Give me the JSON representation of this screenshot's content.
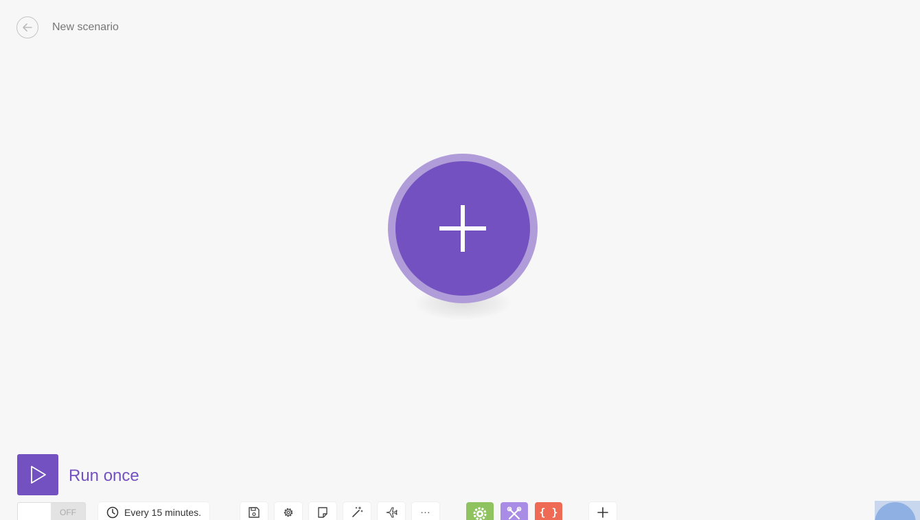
{
  "header": {
    "title": "New scenario",
    "back_icon": "arrow-left-icon"
  },
  "canvas": {
    "add_module_icon": "plus-icon",
    "colors": {
      "module_fill": "#7451c0",
      "module_ring": "#b09cd9"
    }
  },
  "run": {
    "label": "Run once",
    "icon": "play-icon"
  },
  "scheduling": {
    "toggle_state": "OFF",
    "schedule_label": "Every 15 minutes."
  },
  "toolbar": {
    "tools": [
      "save-icon",
      "gear-icon",
      "note-icon",
      "magic-wand-icon",
      "airplane-icon"
    ],
    "more_label": "...",
    "modules": [
      {
        "name": "flow-control",
        "color": "#8ec360"
      },
      {
        "name": "tools",
        "color": "#a98ce6"
      },
      {
        "name": "text-parser",
        "color": "#ef6a55",
        "label": "{ }"
      }
    ],
    "add_icon": "plus-icon"
  }
}
